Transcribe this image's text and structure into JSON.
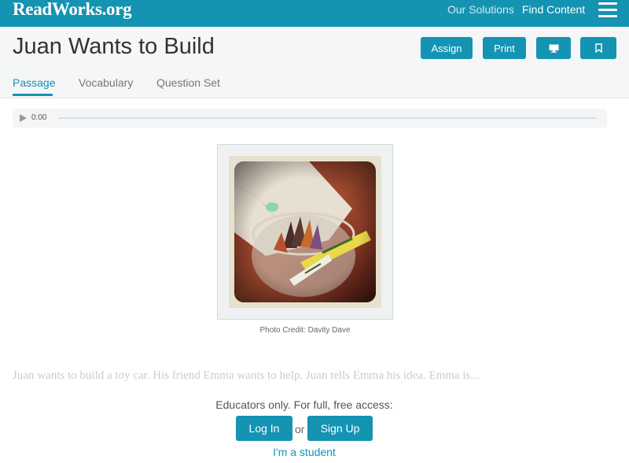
{
  "nav": {
    "logo": "ReadWorks.org",
    "links": [
      "Our Solutions",
      "Find Content"
    ],
    "menu_icon": "hamburger-icon"
  },
  "header": {
    "title": "Juan Wants to Build",
    "buttons": {
      "assign": "Assign",
      "print": "Print",
      "present_icon": "monitor-icon",
      "save_icon": "bookmark-icon"
    },
    "tabs": [
      {
        "label": "Passage",
        "active": true
      },
      {
        "label": "Vocabulary",
        "active": false
      },
      {
        "label": "Question Set",
        "active": false
      }
    ]
  },
  "audio": {
    "time": "0:00",
    "play_icon": "play-icon",
    "progress": 0
  },
  "photo": {
    "credit": "Photo Credit: Davity Dave"
  },
  "passage": {
    "teaser": "Juan wants to build a toy car. His friend Emma wants to help. Juan tells Emma his idea. Emma is..."
  },
  "gate": {
    "message": "Educators only. For full, free access:",
    "login": "Log In",
    "or": "or",
    "signup": "Sign Up",
    "student_link": "I'm a student"
  },
  "colors": {
    "brand": "#1493b3",
    "header_bg": "#f5f6f7"
  }
}
